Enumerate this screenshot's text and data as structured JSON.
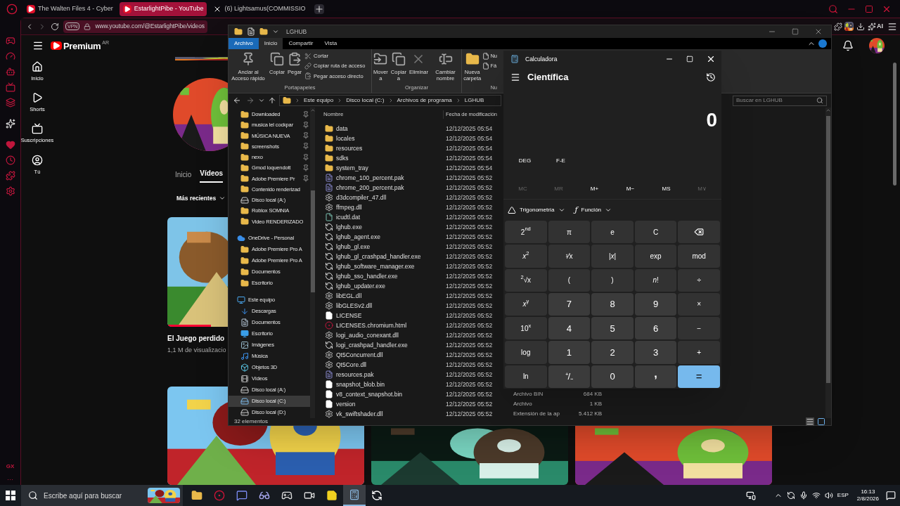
{
  "browser": {
    "tabs": [
      {
        "title": "The Walten Files 4 - Cyber",
        "kind": "youtube",
        "selected": false
      },
      {
        "title": "EstarlightPibe - YouTube",
        "kind": "youtube",
        "selected": true
      },
      {
        "title": "(6) Lightsamus(COMMISSIO",
        "kind": "x",
        "selected": false
      }
    ],
    "vpn": "VPN",
    "url": "www.youtube.com/@EstarlightPibe/videos",
    "ai_label": "AI",
    "sidebar_badge": "GX",
    "sidebar_more": "···"
  },
  "youtube": {
    "logo": "Premium",
    "region": "AR",
    "nav": [
      {
        "label": "Inicio",
        "kind": "home"
      },
      {
        "label": "Shorts",
        "kind": "shorts"
      },
      {
        "label": "Suscripciones",
        "kind": "subscriptions"
      },
      {
        "label": "Tú",
        "kind": "you"
      }
    ],
    "channel_tabs": [
      {
        "label": "Inicio",
        "selected": false
      },
      {
        "label": "Vídeos",
        "selected": true
      }
    ],
    "sort": "Más recientes",
    "videos": [
      {
        "title": "El Juego perdido",
        "views": "1,1 M de visualizacio",
        "level": 0.22
      }
    ]
  },
  "explorer": {
    "title": "LGHUB",
    "ribbon_tabs": [
      {
        "label": "Archivo",
        "kind": "file",
        "selected": false
      },
      {
        "label": "Inicio",
        "kind": "tab",
        "selected": true
      },
      {
        "label": "Compartir",
        "kind": "tab",
        "selected": false
      },
      {
        "label": "Vista",
        "kind": "tab",
        "selected": false
      }
    ],
    "clipboard": {
      "label": "Portapapeles",
      "big": [
        {
          "label": "Anclar al Acceso rápido",
          "kind": "pin"
        },
        {
          "label": "Copiar",
          "kind": "copy"
        },
        {
          "label": "Pegar",
          "kind": "paste"
        }
      ],
      "small": [
        {
          "label": "Cortar",
          "kind": "cut"
        },
        {
          "label": "Copiar ruta de acceso",
          "kind": "path"
        },
        {
          "label": "Pegar acceso directo",
          "kind": "shortcut"
        }
      ]
    },
    "organize": {
      "label": "Organizar",
      "buttons": [
        {
          "label": "Mover a",
          "kind": "move"
        },
        {
          "label": "Copiar a",
          "kind": "copyto"
        },
        {
          "label": "Eliminar",
          "kind": "delete"
        },
        {
          "label": "Cambiar nombre",
          "kind": "rename"
        }
      ]
    },
    "new": {
      "label": "Nu",
      "buttons": [
        {
          "label": "Nueva carpeta",
          "kind": "folder"
        }
      ],
      "small": [
        "Nu",
        "Fá"
      ]
    },
    "breadcrumb": [
      "Este equipo",
      "Disco local (C:)",
      "Archivos de programa",
      "LGHUB"
    ],
    "search": {
      "placeholder": "Buscar en LGHUB"
    },
    "quick_access": [
      {
        "label": "Downloaded",
        "kind": "folder",
        "pinned": true,
        "selected": false
      },
      {
        "label": "musica lel cockpar",
        "kind": "folder",
        "pinned": true,
        "selected": false
      },
      {
        "label": "MÚSICA NUEVA",
        "kind": "folder",
        "pinned": true,
        "selected": false
      },
      {
        "label": "screenshots",
        "kind": "folder",
        "pinned": true,
        "selected": false
      },
      {
        "label": "nexo",
        "kind": "folder",
        "pinned": true,
        "selected": false
      },
      {
        "label": "Gmod loquendott",
        "kind": "folder",
        "pinned": true,
        "selected": false
      },
      {
        "label": "Adobe Premiere Pr",
        "kind": "folder",
        "pinned": true,
        "selected": false
      },
      {
        "label": "Contenido renderizad",
        "kind": "folder",
        "pinned": false,
        "selected": false
      },
      {
        "label": "Disco local (A:)",
        "kind": "drive",
        "pinned": false,
        "selected": false
      },
      {
        "label": "Roblox SOMNIA",
        "kind": "folder",
        "pinned": false,
        "selected": false
      },
      {
        "label": "Video RENDERIZADO",
        "kind": "folder",
        "pinned": false,
        "selected": false
      }
    ],
    "nav": [
      {
        "label": "OneDrive - Personal",
        "kind": "cloud",
        "selected": false,
        "children": [
          {
            "label": "Adobe Premiere Pro A",
            "kind": "folder",
            "selected": false
          },
          {
            "label": "Adobe Premiere Pro A",
            "kind": "folder",
            "selected": false
          },
          {
            "label": "Documentos",
            "kind": "folder",
            "selected": false
          },
          {
            "label": "Escritorio",
            "kind": "folder",
            "selected": false
          }
        ]
      },
      {
        "label": "Este equipo",
        "kind": "pc",
        "selected": false,
        "children": [
          {
            "label": "Descargas",
            "kind": "downloads",
            "selected": false
          },
          {
            "label": "Documentos",
            "kind": "documents",
            "selected": false
          },
          {
            "label": "Escritorio",
            "kind": "desktop",
            "selected": false
          },
          {
            "label": "Imágenes",
            "kind": "pictures",
            "selected": false
          },
          {
            "label": "Música",
            "kind": "music",
            "selected": false
          },
          {
            "label": "Objetos 3D",
            "kind": "objects",
            "selected": false
          },
          {
            "label": "Vídeos",
            "kind": "videos",
            "selected": false
          },
          {
            "label": "Disco local (A:)",
            "kind": "drive",
            "selected": false
          },
          {
            "label": "Disco local (C:)",
            "kind": "system",
            "selected": true
          },
          {
            "label": "Disco local (D:)",
            "kind": "drive",
            "selected": false
          }
        ]
      }
    ],
    "columns": [
      "Nombre",
      "Fecha de modificación"
    ],
    "files": [
      {
        "name": "data",
        "date": "12/12/2025 05:54",
        "kind": "folder"
      },
      {
        "name": "locales",
        "date": "12/12/2025 05:54",
        "kind": "folder"
      },
      {
        "name": "resources",
        "date": "12/12/2025 05:54",
        "kind": "folder"
      },
      {
        "name": "sdks",
        "date": "12/12/2025 05:54",
        "kind": "folder"
      },
      {
        "name": "system_tray",
        "date": "12/12/2025 05:54",
        "kind": "folder"
      },
      {
        "name": "chrome_100_percent.pak",
        "date": "12/12/2025 05:52",
        "kind": "pak"
      },
      {
        "name": "chrome_200_percent.pak",
        "date": "12/12/2025 05:52",
        "kind": "pak"
      },
      {
        "name": "d3dcompiler_47.dll",
        "date": "12/12/2025 05:52",
        "kind": "dll"
      },
      {
        "name": "ffmpeg.dll",
        "date": "12/12/2025 05:52",
        "kind": "dll"
      },
      {
        "name": "icudtl.dat",
        "date": "12/12/2025 05:52",
        "kind": "dat"
      },
      {
        "name": "lghub.exe",
        "date": "12/12/2025 05:52",
        "kind": "exe"
      },
      {
        "name": "lghub_agent.exe",
        "date": "12/12/2025 05:52",
        "kind": "exe"
      },
      {
        "name": "lghub_gl.exe",
        "date": "12/12/2025 05:52",
        "kind": "exe"
      },
      {
        "name": "lghub_gl_crashpad_handler.exe",
        "date": "12/12/2025 05:52",
        "kind": "exe"
      },
      {
        "name": "lghub_software_manager.exe",
        "date": "12/12/2025 05:52",
        "kind": "exe"
      },
      {
        "name": "lghub_sso_handler.exe",
        "date": "12/12/2025 05:52",
        "kind": "exe"
      },
      {
        "name": "lghub_updater.exe",
        "date": "12/12/2025 05:52",
        "kind": "exe"
      },
      {
        "name": "libEGL.dll",
        "date": "12/12/2025 05:52",
        "kind": "dll"
      },
      {
        "name": "libGLESv2.dll",
        "date": "12/12/2025 05:52",
        "kind": "dll"
      },
      {
        "name": "LICENSE",
        "date": "12/12/2025 05:52",
        "kind": "file"
      },
      {
        "name": "LICENSES.chromium.html",
        "date": "12/12/2025 05:52",
        "kind": "html"
      },
      {
        "name": "logi_audio_conexant.dll",
        "date": "12/12/2025 05:52",
        "kind": "dll"
      },
      {
        "name": "logi_crashpad_handler.exe",
        "date": "12/12/2025 05:52",
        "kind": "exe"
      },
      {
        "name": "Qt5Concurrent.dll",
        "date": "12/12/2025 05:52",
        "kind": "dll"
      },
      {
        "name": "Qt5Core.dll",
        "date": "12/12/2025 05:52",
        "kind": "dll"
      },
      {
        "name": "resources.pak",
        "date": "12/12/2025 05:52",
        "kind": "pak"
      },
      {
        "name": "snapshot_blob.bin",
        "date": "12/12/2025 05:52",
        "kind": "file"
      },
      {
        "name": "v8_context_snapshot.bin",
        "date": "12/12/2025 05:52",
        "kind": "file",
        "type": "Archivo BIN",
        "size": "684 KB"
      },
      {
        "name": "version",
        "date": "12/12/2025 05:52",
        "kind": "file",
        "type": "Archivo",
        "size": "1 KB"
      },
      {
        "name": "vk_swiftshader.dll",
        "date": "12/12/2025 05:52",
        "kind": "dll",
        "type": "Extensión de la ap",
        "size": "5.412 KB"
      }
    ],
    "status": "32 elementos"
  },
  "calculator": {
    "title": "Calculadora",
    "mode": "Científica",
    "display": "0",
    "angle": "DEG",
    "fe": "F-E",
    "memory": [
      {
        "label": "MC",
        "disabled": true
      },
      {
        "label": "MR",
        "disabled": true
      },
      {
        "label": "M+",
        "disabled": false
      },
      {
        "label": "M−",
        "disabled": false
      },
      {
        "label": "MS",
        "disabled": false
      },
      {
        "label": "M∨",
        "disabled": true
      }
    ],
    "dropdowns": [
      {
        "label": "Trigonometría",
        "kind": "trig"
      },
      {
        "label": "Función",
        "kind": "function",
        "glyph": "ƒ"
      }
    ],
    "keys": [
      {
        "label": "2$^{nd}$",
        "kind": "fn"
      },
      {
        "label": "π",
        "kind": "fn"
      },
      {
        "label": "e",
        "kind": "fn"
      },
      {
        "label": "C",
        "kind": "fn"
      },
      {
        "kind": "backspace"
      },
      {
        "label": "*x*$^{2}$",
        "kind": "fn"
      },
      {
        "label": "¹⁄x",
        "kind": "fn"
      },
      {
        "label": "|*x*|",
        "kind": "fn"
      },
      {
        "label": "exp",
        "kind": "fn"
      },
      {
        "label": "mod",
        "kind": "fn"
      },
      {
        "label": "$^{2}$√x",
        "kind": "fn"
      },
      {
        "label": "(",
        "kind": "fn"
      },
      {
        "label": ")",
        "kind": "fn"
      },
      {
        "label": "*n*!",
        "kind": "fn"
      },
      {
        "label": "÷",
        "kind": "fn"
      },
      {
        "label": "*x*$^{y}$",
        "kind": "fn"
      },
      {
        "label": "7",
        "kind": "num"
      },
      {
        "label": "8",
        "kind": "num"
      },
      {
        "label": "9",
        "kind": "num"
      },
      {
        "label": "×",
        "kind": "fn"
      },
      {
        "label": "10$^{x}$",
        "kind": "fn"
      },
      {
        "label": "4",
        "kind": "num"
      },
      {
        "label": "5",
        "kind": "num"
      },
      {
        "label": "6",
        "kind": "num"
      },
      {
        "label": "−",
        "kind": "fn"
      },
      {
        "label": "log",
        "kind": "fn"
      },
      {
        "label": "1",
        "kind": "num"
      },
      {
        "label": "2",
        "kind": "num"
      },
      {
        "label": "3",
        "kind": "num"
      },
      {
        "label": "+",
        "kind": "fn"
      },
      {
        "label": "ln",
        "kind": "fn"
      },
      {
        "label": "⁺/₋",
        "kind": "num"
      },
      {
        "label": "0",
        "kind": "num"
      },
      {
        "label": ",",
        "kind": "decimal"
      },
      {
        "label": "=",
        "kind": "equals"
      }
    ]
  },
  "taskbar": {
    "search": {
      "placeholder": "Escribe aquí para buscar"
    },
    "apps": [
      {
        "kind": "folder",
        "selected": false
      },
      {
        "kind": "opera",
        "selected": false
      },
      {
        "kind": "discord",
        "selected": false
      },
      {
        "kind": "vr",
        "selected": false
      },
      {
        "kind": "steam",
        "selected": false
      },
      {
        "kind": "recorder",
        "selected": false
      },
      {
        "kind": "notes",
        "selected": false
      },
      {
        "kind": "calculator",
        "selected": true
      },
      {
        "kind": "ghub",
        "selected": false
      }
    ],
    "language": "ESP",
    "time": "16:13",
    "date": "2/8/2026"
  }
}
